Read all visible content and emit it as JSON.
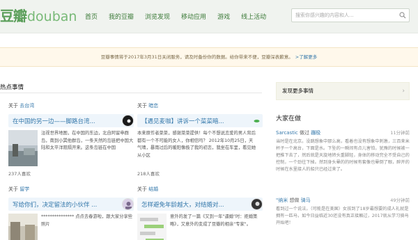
{
  "brand": {
    "cn": "豆瓣",
    "en": "douban"
  },
  "nav": [
    "首页",
    "我的豆瓣",
    "浏览发现",
    "移动应用",
    "游戏",
    "线上活动"
  ],
  "search": {
    "placeholder": "搜索你感兴趣的内容和人..."
  },
  "notice": {
    "text": "豆瓣事情将于2017年3月31日关闭服务，请及时备份你的数据。给你带来不便，豆瓣深表歉意。",
    "link": "了解更多"
  },
  "hot": {
    "title": "热点事情",
    "cards": [
      {
        "about_prefix": "关于",
        "topic": "去台湾",
        "title": "在中国的另一边——脚路台湾...",
        "text": "注视世界地图，在中国的东边，北自阿留申群岛，南到小巽他群岛，一条天然的岛链把中国大陆和太平洋阻隔开来。这条岛链在中国",
        "likes": "237人喜欢"
      },
      {
        "about_prefix": "关于",
        "topic": "暗恋",
        "title": "【遇见麦咖】讲诉一个菜菜暗...",
        "text": "本来原作者菜菜，感谢菜菜提供！每个不想说恋爱的男人背后都有一个不可能的女人，你相信吗？ 2012年10月25日，天气晴，暴雨过后的暖阳像极了我的初恋，我坐在车里，看见她从小区",
        "likes": "218人喜欢"
      },
      {
        "about_prefix": "关于",
        "topic": "留学",
        "title": "写给你们，决定留法的小伙伴 ...",
        "text": "*************** 点点去春游啦，跟大家分享些照片"
      },
      {
        "about_prefix": "关于",
        "topic": "结婚",
        "title": "怎样避免年龄越大，对结婚对...",
        "text": "意外的发了一篇《又到一年\"逼婚\"时：拒婚策略》，又意外的变成了豆瓣的相亲\"专家\"。"
      }
    ]
  },
  "sidebar": {
    "discover": "发现更多事情",
    "doing_title": "大家在做",
    "feeds": [
      {
        "user": "Sarcastic",
        "action": "做过",
        "event": "蹦极",
        "time": "11分钟前",
        "text": "当时是在北京。没跳想象中那么高，看着也没有想象中刺激，三百来米杯子一个高台，下面是水。下坠的一瞬间有点儿害怕，犹豫的时候被一把推下去了，然后就是天旋地转头重脚轻，身体的移动完全不受自己的控制，一个劲往下掉。然到身头晕的的时候有套像也晕倒了眼，醉开的时候在水里接人的船只已经过来了。"
      },
      {
        "user": "\"纳米",
        "action": "想做",
        "event": "骑马",
        "time": "49分钟前",
        "text": "看到过一个说法，（可能是在美国）女孩到了18岁最想要的成人礼就是拥有一匹马，如今日益临近30还没有真正接触过，2017就从学习骑马开始吧！"
      }
    ]
  },
  "colors": {
    "brand_green": "#5a9e59",
    "link_blue": "#3377aa",
    "nav_green": "#3b7a38",
    "notice_bg": "#fff8eb"
  }
}
